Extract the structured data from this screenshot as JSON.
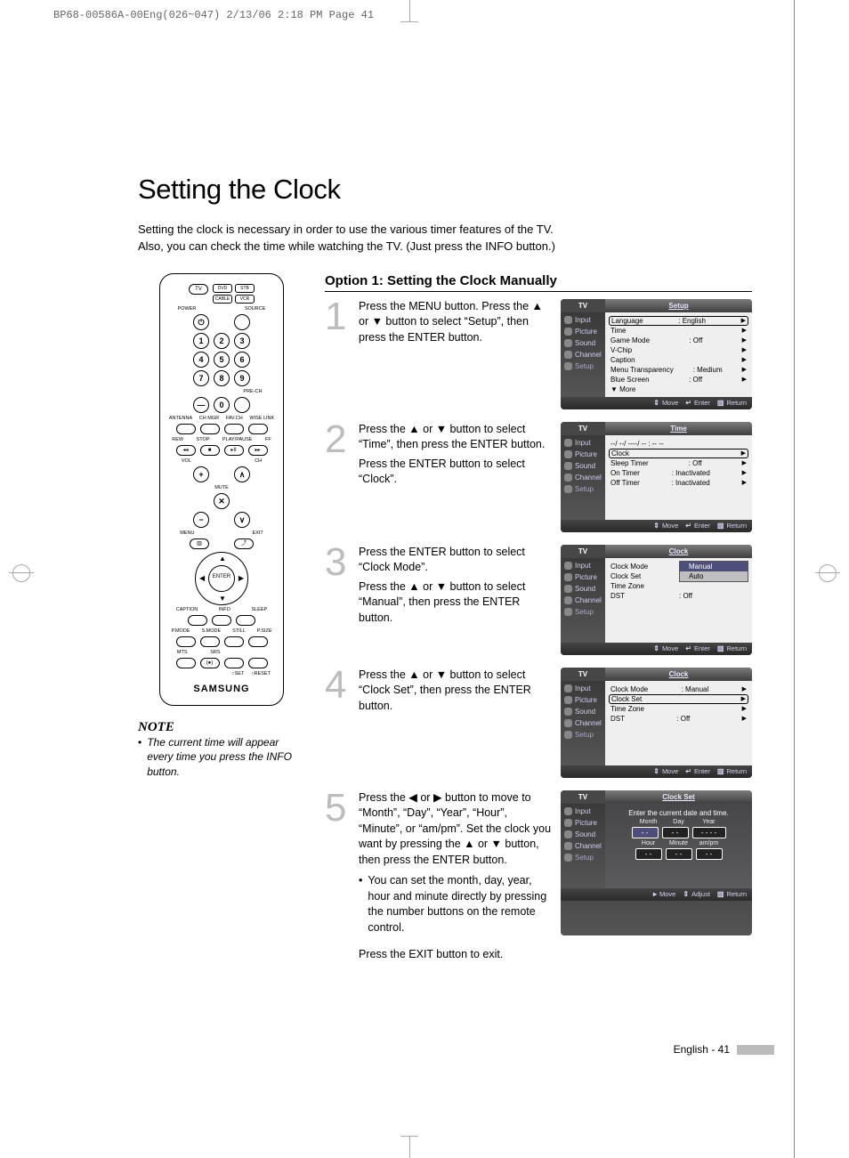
{
  "crop_header": "BP68-00586A-00Eng(026~047)  2/13/06  2:18 PM  Page 41",
  "title": "Setting the Clock",
  "intro_a": "Setting the clock is necessary in order to use the various timer features of the TV.",
  "intro_b": "Also, you can check the time while watching the TV. (Just press the INFO button.)",
  "section_title": "Option 1: Setting the Clock Manually",
  "steps": {
    "s1": {
      "n": "1",
      "text": "Press the MENU button. Press the ▲ or ▼ button to select “Setup”, then press the ENTER button."
    },
    "s2": {
      "n": "2",
      "t1": "Press the ▲ or ▼ button to select “Time”, then press the ENTER button.",
      "t2": "Press the ENTER button to select “Clock”."
    },
    "s3": {
      "n": "3",
      "t1": "Press the ENTER button to select “Clock Mode”.",
      "t2": "Press the ▲ or ▼ button to select “Manual”, then press the ENTER button."
    },
    "s4": {
      "n": "4",
      "text": "Press the ▲ or ▼ button to select “Clock Set”, then press the ENTER button."
    },
    "s5": {
      "n": "5",
      "text": "Press the ◀ or ▶ button to move to “Month”, “Day”, “Year”, “Hour”, “Minute”, or “am/pm”. Set the clock you want by pressing the ▲ or ▼ button, then press the ENTER button.",
      "bullet": "You can set the month, day, year, hour and minute directly by pressing the number buttons on the remote control."
    },
    "final": "Press the EXIT button to exit."
  },
  "note": {
    "title": "NOTE",
    "body": "The current time will appear every time you press the INFO button."
  },
  "footer": {
    "label": "English - 41"
  },
  "osd": {
    "tv": "TV",
    "side": [
      "Input",
      "Picture",
      "Sound",
      "Channel",
      "Setup"
    ],
    "foot": {
      "move": "Move",
      "enter": "Enter",
      "return": "Return",
      "adjust": "Adjust"
    },
    "s1": {
      "title": "Setup",
      "rows": [
        [
          "Language",
          ": English",
          "▶"
        ],
        [
          "Time",
          "",
          "▶"
        ],
        [
          "Game Mode",
          ": Off",
          "▶"
        ],
        [
          "V-Chip",
          "",
          "▶"
        ],
        [
          "Caption",
          "",
          "▶"
        ],
        [
          "Menu Transparency",
          ": Medium",
          "▶"
        ],
        [
          "Blue Screen",
          ": Off",
          "▶"
        ],
        [
          "▼ More",
          "",
          ""
        ]
      ]
    },
    "s2": {
      "title": "Time",
      "dt": "--/ --/ ----/ -- : -- --",
      "rows": [
        [
          "Clock",
          "",
          "▶"
        ],
        [
          "Sleep Timer",
          ": Off",
          "▶"
        ],
        [
          "On Timer",
          ": Inactivated",
          "▶"
        ],
        [
          "Off Timer",
          ": Inactivated",
          "▶"
        ]
      ]
    },
    "s3": {
      "title": "Clock",
      "rows": [
        [
          "Clock Mode",
          "",
          ""
        ],
        [
          "Clock Set",
          "",
          ""
        ],
        [
          "Time Zone",
          "",
          ""
        ],
        [
          "DST",
          ": Off",
          ""
        ]
      ],
      "popup": [
        "Manual",
        "Auto"
      ]
    },
    "s4": {
      "title": "Clock",
      "rows": [
        [
          "Clock Mode",
          ": Manual",
          "▶"
        ],
        [
          "Clock Set",
          "",
          "▶"
        ],
        [
          "Time Zone",
          "",
          "▶"
        ],
        [
          "DST",
          ": Off",
          "▶"
        ]
      ]
    },
    "s5": {
      "title": "Clock Set",
      "prompt": "Enter the current date and time.",
      "labels1": [
        "Month",
        "Day",
        "Year"
      ],
      "vals1": [
        "- -",
        "- -",
        "- - - -"
      ],
      "labels2": [
        "Hour",
        "Minute",
        "am/pm"
      ],
      "vals2": [
        "- -",
        "- -",
        "- -"
      ]
    }
  },
  "remote": {
    "top_rects": [
      "DVD",
      "STB",
      "CABLE",
      "VCR"
    ],
    "tv": "TV",
    "power": "POWER",
    "source": "SOURCE",
    "digits": [
      "1",
      "2",
      "3",
      "4",
      "5",
      "6",
      "7",
      "8",
      "9",
      "0"
    ],
    "dash": "—",
    "prech": "PRE-CH",
    "row_a": [
      "ANTENNA",
      "CH MGR",
      "FAV.CH",
      "WISE LINK"
    ],
    "row_b": [
      "REW",
      "STOP",
      "PLAY/PAUSE",
      "FF"
    ],
    "vol": "VOL",
    "ch": "CH",
    "mute": "MUTE",
    "menu": "MENU",
    "exit": "EXIT",
    "enter": "ENTER",
    "row_c": [
      "CAPTION",
      "INFO",
      "SLEEP"
    ],
    "row_d": [
      "P.MODE",
      "S.MODE",
      "STILL",
      "P.SIZE"
    ],
    "row_e": [
      "MTS",
      "SRS"
    ],
    "row_f": [
      "SET",
      "RESET"
    ],
    "brand": "SAMSUNG"
  }
}
